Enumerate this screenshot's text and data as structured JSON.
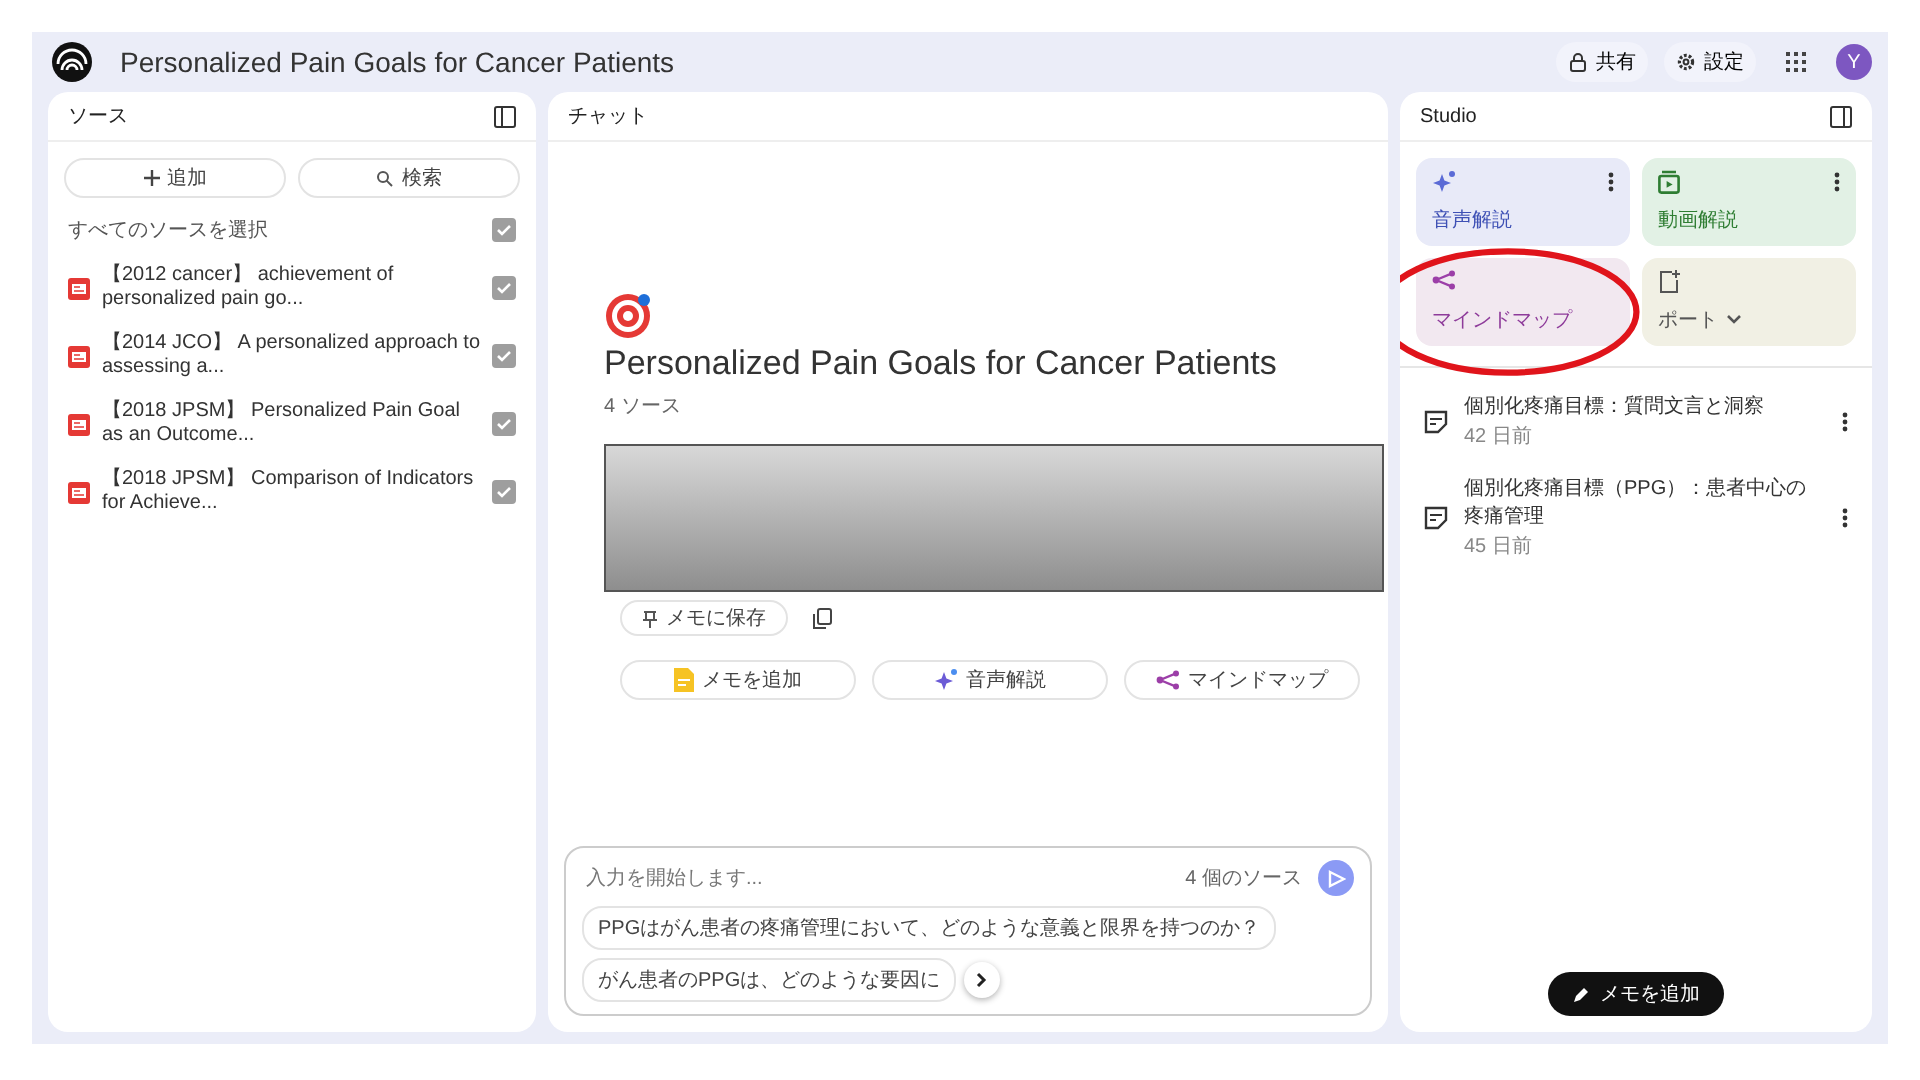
{
  "app": {
    "title": "Personalized Pain Goals for Cancer Patients"
  },
  "header_actions": [
    {
      "label": "共有",
      "kind": "share"
    },
    {
      "label": "設定",
      "kind": "settings"
    }
  ],
  "avatar": {
    "initial": "Y"
  },
  "sources": {
    "title": "ソース",
    "buttons": [
      {
        "label": "追加",
        "kind": "add"
      },
      {
        "label": "検索",
        "kind": "search"
      }
    ],
    "select_all": {
      "label": "すべてのソースを選択",
      "checked": true
    },
    "items": [
      {
        "title": "【2012 cancer】 achievement of personalized pain go...",
        "checked": true
      },
      {
        "title": "【2014 JCO】 A personalized approach to assessing a...",
        "checked": true
      },
      {
        "title": "【2018 JPSM】 Personalized Pain Goal as an Outcome...",
        "checked": true
      },
      {
        "title": "【2018 JPSM】 Comparison of Indicators for Achieve...",
        "checked": true
      }
    ]
  },
  "chat": {
    "title": "チャット",
    "notebook_title": "Personalized Pain Goals for Cancer Patients",
    "source_count": "4 ソース",
    "save_button": "メモに保存",
    "actions": [
      {
        "label": "メモを追加",
        "kind": "note"
      },
      {
        "label": "音声解説",
        "kind": "audio"
      },
      {
        "label": "マインドマップ",
        "kind": "mindmap"
      }
    ],
    "input": {
      "placeholder": "入力を開始します...",
      "source_count": "4 個のソース"
    },
    "suggestions": [
      "PPGはがん患者の疼痛管理において、どのような意義と限界を持つのか？",
      "がん患者のPPGは、どのような要因に"
    ]
  },
  "studio": {
    "title": "Studio",
    "tiles": [
      {
        "label": "音声解説",
        "kind": "audio",
        "color": "#e8eaf8"
      },
      {
        "label": "動画解説",
        "kind": "video",
        "color": "#e2f1e5"
      },
      {
        "label": "マインドマップ",
        "kind": "mindmap",
        "color": "#f2e8f0"
      },
      {
        "label": "ポート",
        "kind": "report",
        "color": "#f1f0e4"
      }
    ],
    "notes": [
      {
        "title": "個別化疼痛目標：質問文言と洞察",
        "age": "42 日前"
      },
      {
        "title": "個別化疼痛目標（PPG）：患者中心の疼痛管理",
        "age": "45 日前"
      }
    ],
    "add_note_button": "メモを追加"
  }
}
